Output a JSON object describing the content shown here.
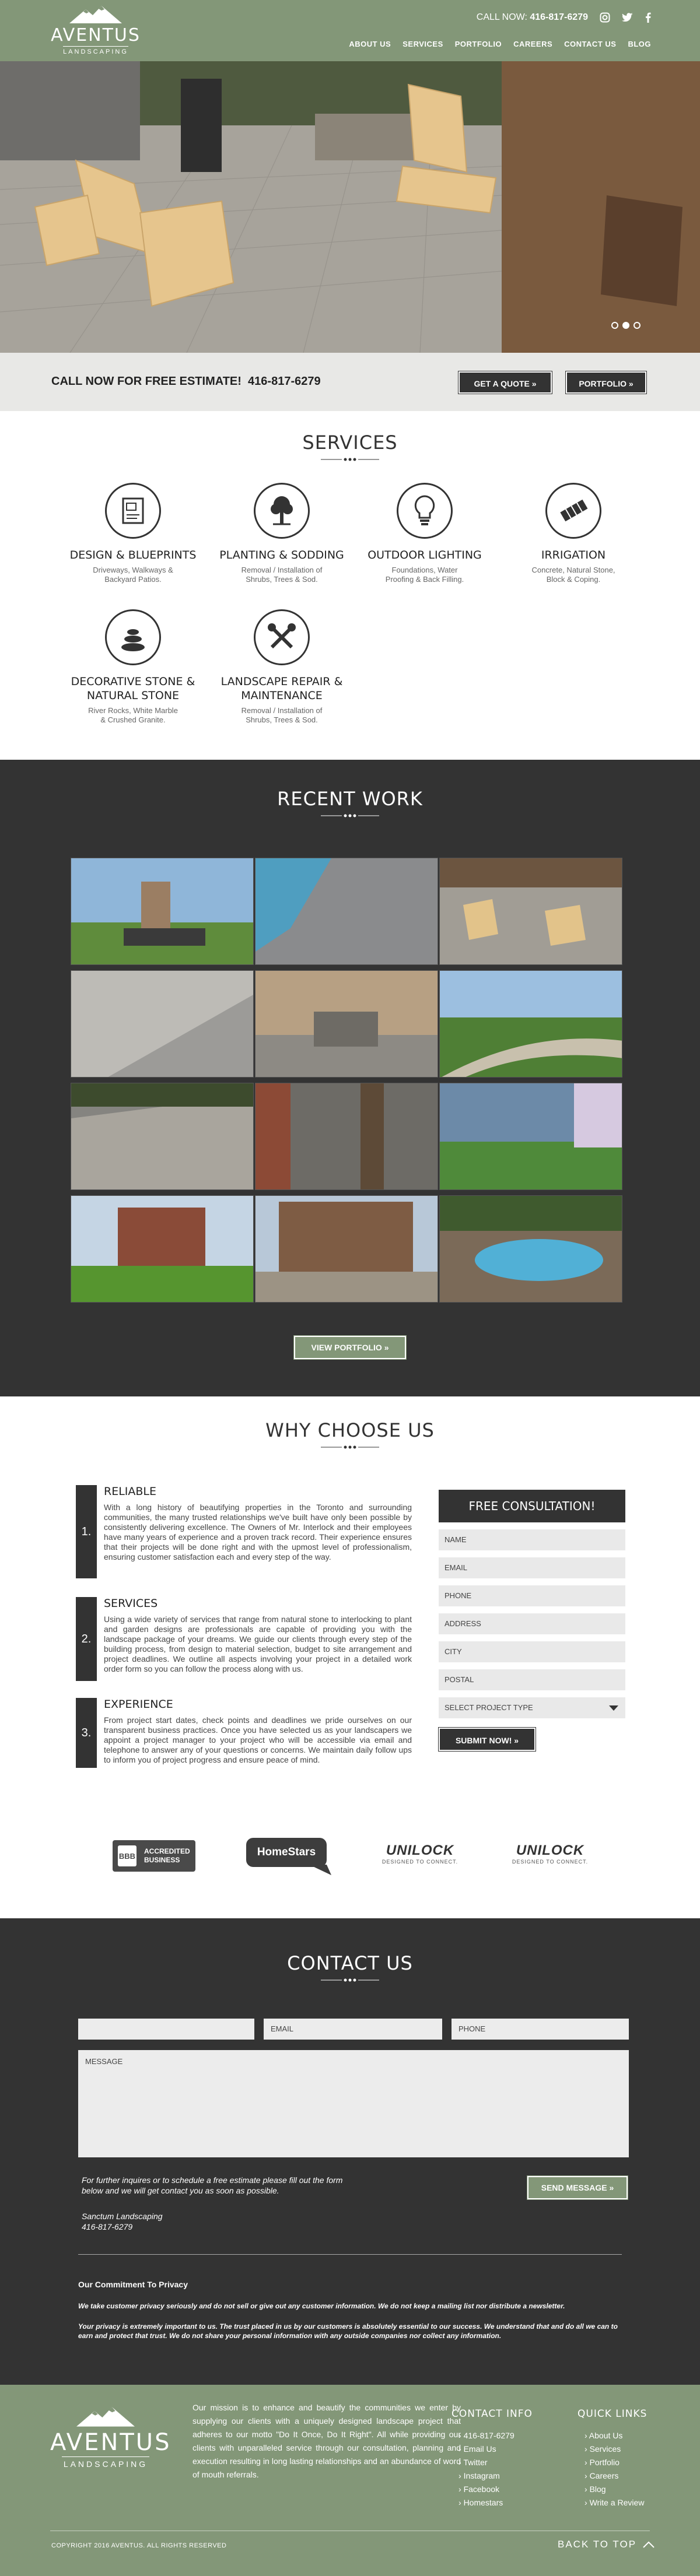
{
  "header": {
    "logo_name": "AVENTUS",
    "logo_sub": "LANDSCAPING",
    "call_label": "CALL NOW:",
    "phone": "416-817-6279",
    "nav": [
      "ABOUT US",
      "SERVICES",
      "PORTFOLIO",
      "CAREERS",
      "CONTACT US",
      "BLOG"
    ]
  },
  "cta": {
    "text": "CALL NOW FOR FREE ESTIMATE!",
    "phone": "416-817-6279",
    "quote_btn": "GET A QUOTE »",
    "portfolio_btn": "PORTFOLIO »"
  },
  "services": {
    "title": "SERVICES",
    "items": [
      {
        "title": "DESIGN & BLUEPRINTS",
        "desc": "Driveways, Walkways & Backyard Patios.",
        "icon": "blueprint-icon"
      },
      {
        "title": "PLANTING & SODDING",
        "desc": "Removal / Installation of Shrubs, Trees & Sod.",
        "icon": "tree-icon"
      },
      {
        "title": "OUTDOOR LIGHTING",
        "desc": "Foundations, Water Proofing & Back Filling.",
        "icon": "lightbulb-icon"
      },
      {
        "title": "IRRIGATION",
        "desc": "Concrete, Natural Stone, Block & Coping.",
        "icon": "pavers-icon"
      },
      {
        "title": "DECORATIVE STONE & NATURAL STONE",
        "desc": "River Rocks, White Marble & Crushed Granite.",
        "icon": "stones-icon"
      },
      {
        "title": "LANDSCAPE REPAIR & MAINTENANCE",
        "desc": "Removal / Installation of Shrubs, Trees & Sod.",
        "icon": "tools-icon"
      }
    ]
  },
  "recent_work": {
    "title": "RECENT WORK",
    "button": "VIEW PORTFOLIO »"
  },
  "why": {
    "title": "WHY CHOOSE US",
    "reasons": [
      {
        "num": "1.",
        "title": "RELIABLE",
        "text": "With a long history of beautifying properties in the Toronto and surrounding communities, the many trusted relationships we've built have only been possible by consistently delivering excellence. The Owners of Mr. Interlock and their employees have many years of experience and a proven track record. Their experience ensures that their projects will be done right and with the upmost level of professionalism, ensuring customer satisfaction each and every step of the way."
      },
      {
        "num": "2.",
        "title": "SERVICES",
        "text": "Using a wide variety of services that range from natural stone to interlocking to plant and garden designs are professionals are capable of providing you with the landscape package of your dreams. We guide our clients through every step of the building process, from design to material selection, budget to site arrangement and project deadlines. We outline all aspects involving your project in a detailed work order form so you can follow the process along with us."
      },
      {
        "num": "3.",
        "title": "EXPERIENCE",
        "text": "From project start dates, check points and deadlines we pride ourselves on our transparent business practices. Once you have selected us as your landscapers we appoint a project manager to your project who will be accessible via email and telephone to answer any of your questions or concerns. We maintain daily follow ups to inform you of project progress and ensure peace of mind."
      }
    ]
  },
  "consult_form": {
    "title": "FREE CONSULTATION!",
    "fields": [
      "NAME",
      "EMAIL",
      "PHONE",
      "ADDRESS",
      "CITY",
      "POSTAL"
    ],
    "select": "SELECT PROJECT TYPE",
    "submit": "SUBMIT NOW! »"
  },
  "badges": {
    "bbb_line1": "ACCREDITED",
    "bbb_line2": "BUSINESS",
    "homestars": "HomeStars",
    "unilock": "UNILOCK",
    "unilock_tag": "DESIGNED TO CONNECT."
  },
  "contact": {
    "title": "CONTACT US",
    "placeholders": {
      "name": "",
      "email": "EMAIL",
      "phone": "PHONE",
      "message": "MESSAGE"
    },
    "send": "SEND MESSAGE »",
    "intro": "For further inquires or to schedule a free estimate please fill out the form below and we will get contact you as soon as possible.",
    "company": "Sanctum Landscaping",
    "company_phone": "416-817-6279",
    "privacy_title": "Our Commitment To Privacy",
    "privacy_1": "We take customer privacy seriously and do not sell or give out any customer information. We do not keep a mailing list nor distribute a newsletter.",
    "privacy_2": "Your privacy is extremely important to us. The trust placed in us by our customers is absolutely essential to our success. We understand that and do all we can to earn and protect that trust. We do not share your personal information with any outside companies nor collect any information."
  },
  "footer": {
    "mission": "Our mission is to enhance and beautify the communities we enter by supplying our clients with a uniquely designed landscape project that adheres to our motto \"Do It Once, Do It Right\". All while providing our clients with unparalleled service through our consultation, planning and execution resulting in long lasting relationships and an abundance of word of mouth referrals.",
    "contact_title": "CONTACT INFO",
    "contact_items": [
      "416-817-6279",
      "Email Us",
      "Twitter",
      "Instagram",
      "Facebook",
      "Homestars"
    ],
    "links_title": "QUICK LINKS",
    "links": [
      "About Us",
      "Services",
      "Portfolio",
      "Careers",
      "Blog",
      "Write a Review"
    ],
    "copyright": "COPYRIGHT 2016 AVENTUS. ALL RIGHTS RESERVED",
    "back_to_top": "BACK TO TOP"
  },
  "colors": {
    "brand_green": "#839778",
    "dark": "#333333"
  }
}
